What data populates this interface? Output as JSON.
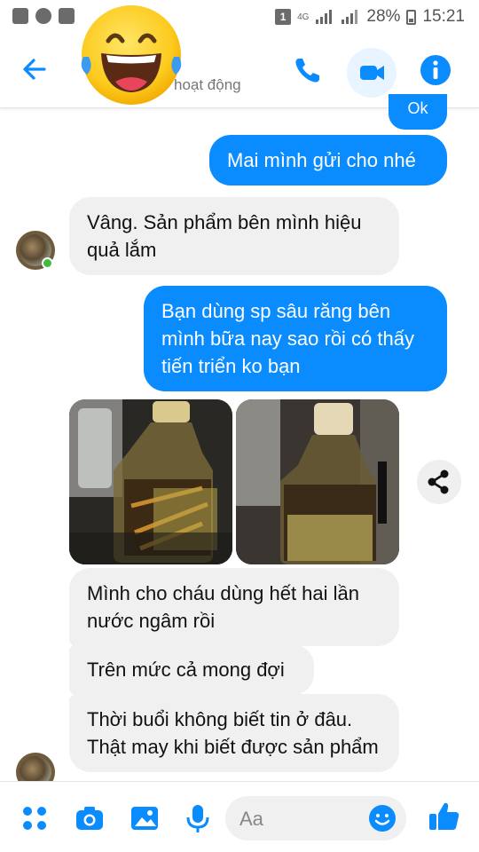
{
  "status_bar": {
    "network": "4G",
    "battery": "28%",
    "time": "15:21"
  },
  "header": {
    "subtitle": "hoạt động"
  },
  "messages": [
    {
      "side": "out",
      "text": "Ok"
    },
    {
      "side": "out",
      "text": "Mai mình gửi cho nhé"
    },
    {
      "side": "in",
      "text": "Vâng. Sản phẩm bên mình hiệu quả lắm"
    },
    {
      "side": "out",
      "text": "Bạn  dùng sp sâu răng bên mình bữa nay sao rồi có thấy tiến triển ko bạn"
    },
    {
      "side": "in",
      "text": "Mình cho cháu dùng hết hai lần nước ngâm rồi"
    },
    {
      "side": "in",
      "text": "Trên mức cả mong đợi"
    },
    {
      "side": "in",
      "text": "Thời buổi không biết tin ở đâu. Thật may khi biết được sản phẩm"
    }
  ],
  "composer": {
    "placeholder": "Aa"
  },
  "colors": {
    "accent": "#0a8cff",
    "incoming_bubble": "#f0f0f0",
    "online": "#3ebd3e"
  },
  "icons": [
    "back-arrow-icon",
    "phone-icon",
    "video-call-icon",
    "info-icon",
    "share-icon",
    "apps-icon",
    "camera-icon",
    "gallery-icon",
    "microphone-icon",
    "emoji-icon",
    "like-icon"
  ]
}
